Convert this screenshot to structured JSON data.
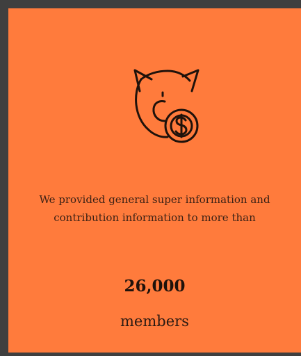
{
  "stat": {
    "icon": "piggy-bank-dollar-icon",
    "description_line1": "We provided general super information and",
    "description_line2": "contribution information to more than",
    "count": "26,000",
    "unit": "members"
  },
  "colors": {
    "card_background": "#ff7b3c",
    "frame_background": "#3f3f3f",
    "text": "#2a1a12"
  }
}
